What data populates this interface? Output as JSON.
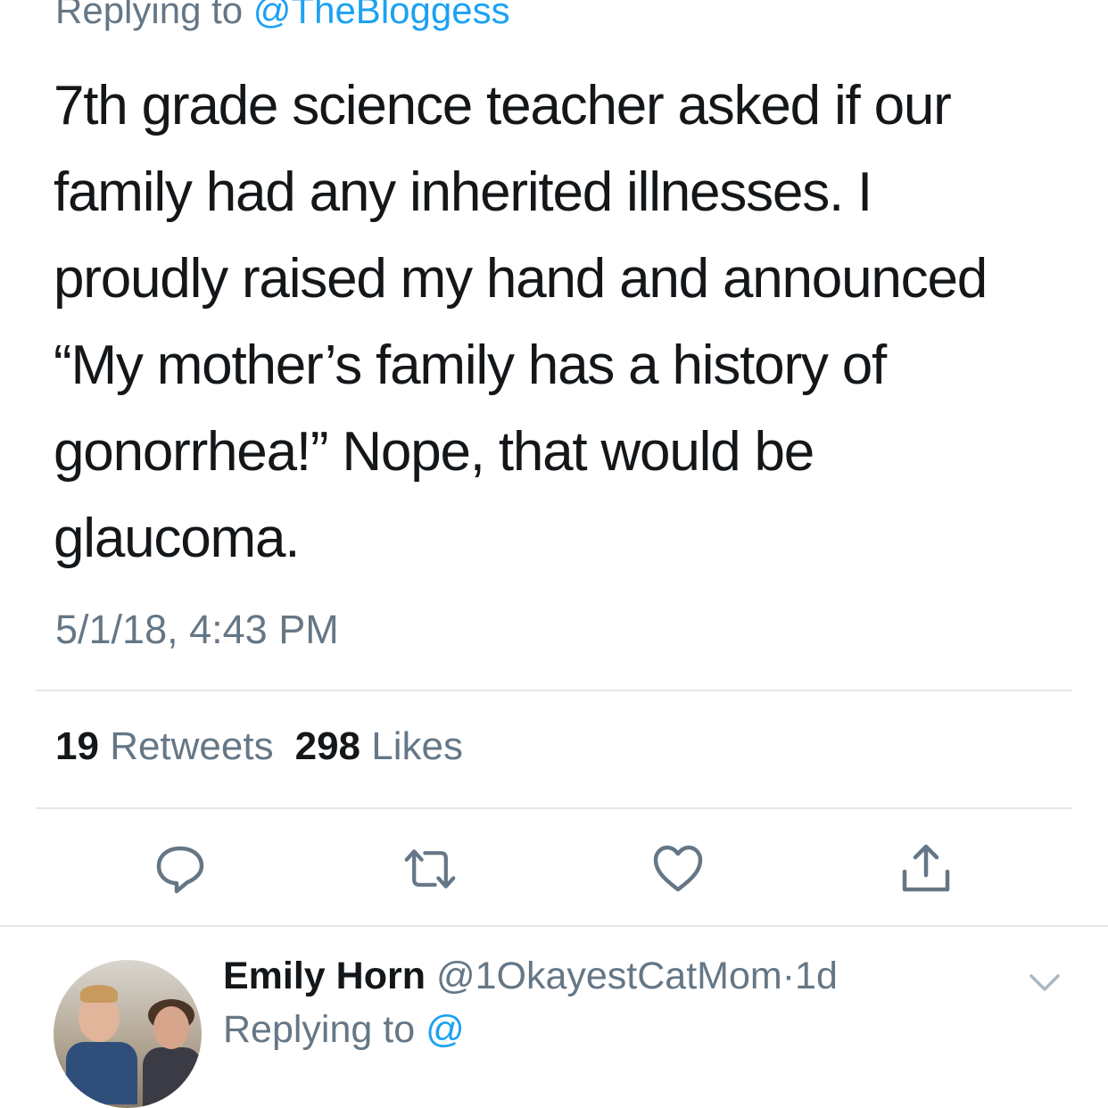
{
  "replying": {
    "prefix": "Replying to ",
    "handle": "@TheBloggess"
  },
  "tweet": {
    "lines": [
      "7th grade science teacher asked if our",
      "family had any inherited illnesses. I",
      "proudly raised my hand and announced",
      "“My mother’s family has a history of",
      "gonorrhea!” Nope, that would be",
      "glaucoma."
    ],
    "timestamp": "5/1/18, 4:43 PM"
  },
  "stats": {
    "retweets_count": "19",
    "retweets_label": "Retweets",
    "likes_count": "298",
    "likes_label": "Likes"
  },
  "actions": {
    "icons": [
      "reply-icon",
      "retweet-icon",
      "like-icon",
      "share-icon"
    ],
    "icon_color": "#657786"
  },
  "reply": {
    "name": "Emily Horn",
    "handle": "@1OkayestCatMom",
    "separator": "·",
    "age": "1d",
    "sub_prefix": "Replying to ",
    "sub_handle": "@"
  },
  "colors": {
    "accent": "#1da1f2",
    "muted": "#657786",
    "text": "#14171a",
    "divider": "#e1e8ed"
  }
}
